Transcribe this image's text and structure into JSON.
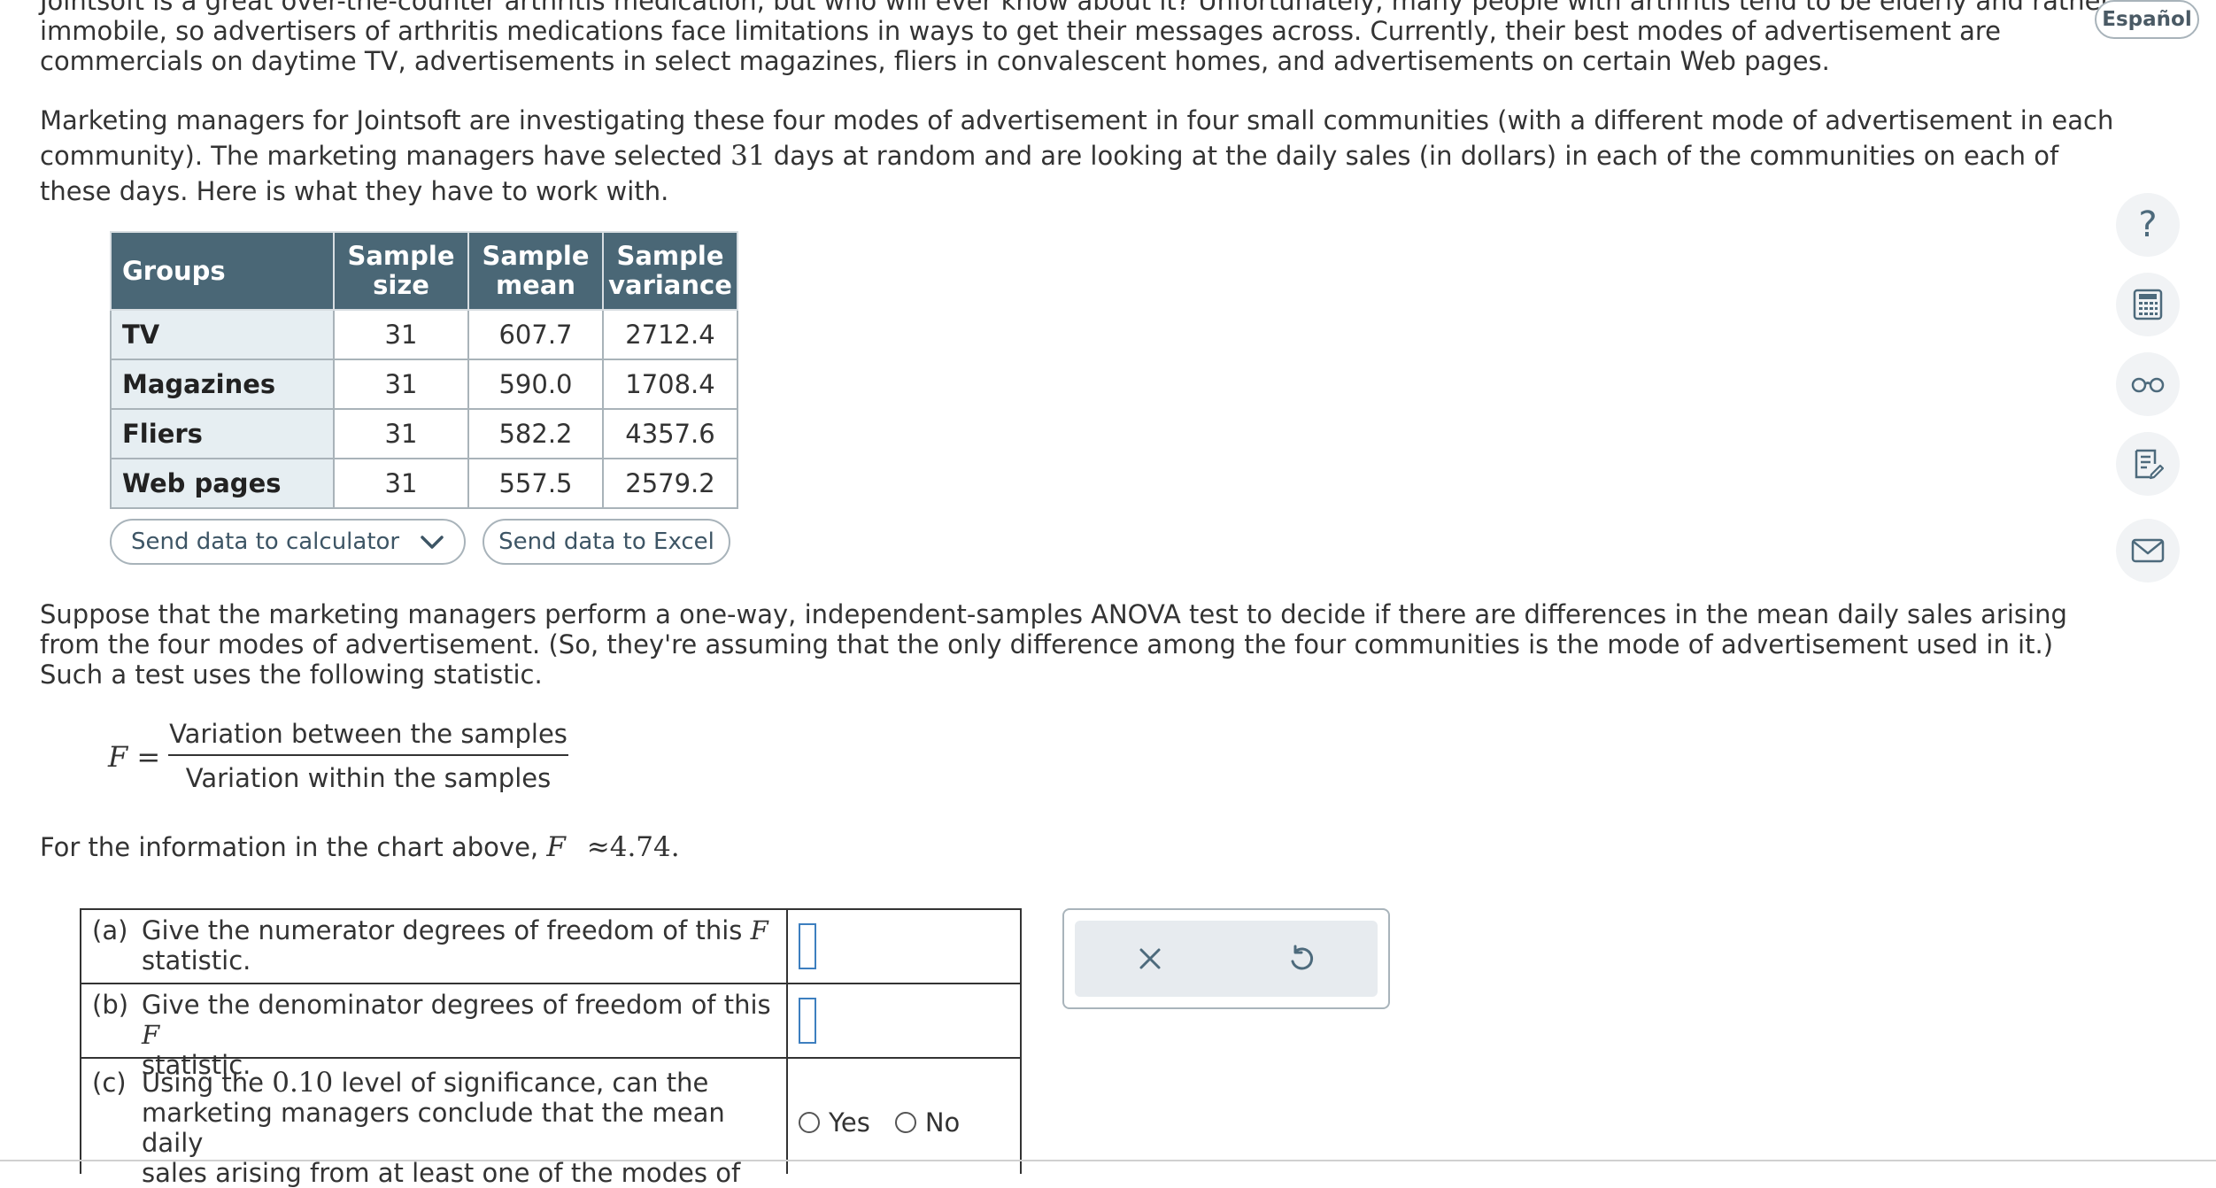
{
  "intro": {
    "line1": "Jointsoft is a great over-the-counter arthritis medication, but who will ever know about it? Unfortunately, many people with arthritis tend to be elderly and rather",
    "line2": "immobile, so advertisers of arthritis medications face limitations in ways to get their messages across. Currently, their best modes of advertisement are",
    "line3": "commercials on daytime TV, advertisements in select magazines, fliers in convalescent homes, and advertisements on certain Web pages."
  },
  "para2": {
    "line1": "Marketing managers for Jointsoft are investigating these four modes of advertisement in four small communities (with a different mode of advertisement in each",
    "line2_a": "community). The marketing managers have selected ",
    "line2_days": "31",
    "line2_b": " days at random and are looking at the daily sales (in dollars) in each of the communities on each of",
    "line3": "these days. Here is what they have to work with."
  },
  "table": {
    "headers": {
      "groups": "Groups",
      "size_1": "Sample",
      "size_2": "size",
      "mean_1": "Sample",
      "mean_2": "mean",
      "var_1": "Sample",
      "var_2": "variance"
    },
    "rows": [
      {
        "group": "TV",
        "size": "31",
        "mean": "607.7",
        "variance": "2712.4"
      },
      {
        "group": "Magazines",
        "size": "31",
        "mean": "590.0",
        "variance": "1708.4"
      },
      {
        "group": "Fliers",
        "size": "31",
        "mean": "582.2",
        "variance": "4357.6"
      },
      {
        "group": "Web pages",
        "size": "31",
        "mean": "557.5",
        "variance": "2579.2"
      }
    ]
  },
  "buttons": {
    "calculator": "Send data to calculator",
    "excel": "Send data to Excel",
    "language": "Español"
  },
  "para3": {
    "line1": "Suppose that the marketing managers perform a one-way, independent-samples ANOVA test to decide if there are differences in the mean daily sales arising",
    "line2": "from the four modes of advertisement. (So, they're assuming that the only difference among the four communities is the mode of advertisement used in it.)",
    "line3": "Such a test uses the following statistic."
  },
  "formula": {
    "lhs": "F =",
    "numerator": "Variation between the samples",
    "denominator": "Variation within the samples"
  },
  "f_value": {
    "prefix": "For the information in the chart above, ",
    "var": "F",
    "approx": " ≈4.74",
    "suffix": "."
  },
  "questions": {
    "a_label": "(a)",
    "a_line1": "Give the numerator degrees of freedom of this ",
    "a_F": "F",
    "a_line2": "statistic.",
    "b_label": "(b)",
    "b_line1": "Give the denominator degrees of freedom of this ",
    "b_F": "F",
    "b_line2": "statistic.",
    "c_label": "(c)",
    "c_line1_a": "Using the ",
    "c_level": "0.10",
    "c_line1_b": " level of significance, can the",
    "c_line2": "marketing managers conclude that the mean daily",
    "c_line3": "sales arising from at least one of the modes of",
    "yes": "Yes",
    "no": "No"
  },
  "icons": {
    "help": "help-icon",
    "calculator": "calculator-icon",
    "glasses": "glasses-icon",
    "notes": "notes-icon",
    "mail": "mail-icon"
  },
  "colors": {
    "table_header": "#4a6776",
    "group_cell": "#e6eef2",
    "answer_blank": "#3d7fbf"
  }
}
